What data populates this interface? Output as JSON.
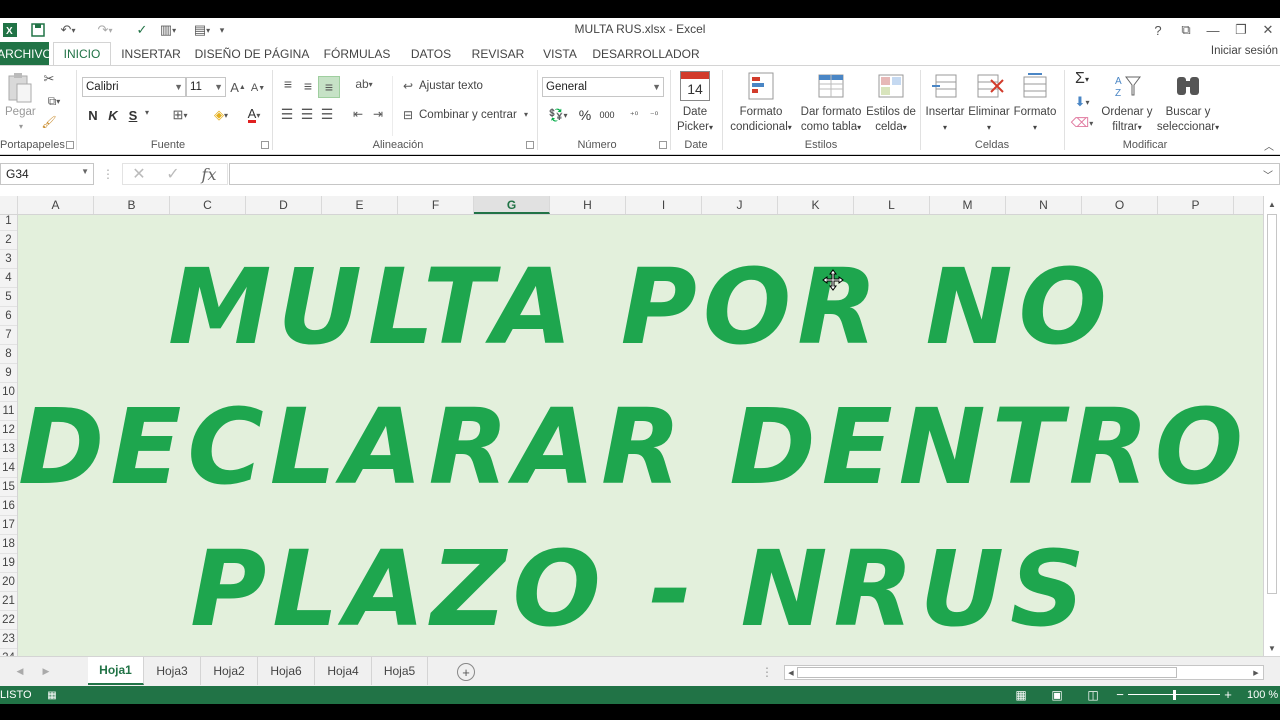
{
  "window": {
    "title": "MULTA RUS.xlsx - Excel",
    "help": "?",
    "restore_ribbon": "⧉",
    "minimize": "—",
    "maximize": "❐",
    "close": "✕"
  },
  "tabs": [
    "ARCHIVO",
    "INICIO",
    "INSERTAR",
    "DISEÑO DE PÁGINA",
    "FÓRMULAS",
    "DATOS",
    "REVISAR",
    "VISTA",
    "DESARROLLADOR"
  ],
  "signin": "Iniciar sesión",
  "ribbon": {
    "clipboard": {
      "pegar": "Pegar",
      "label": "Portapapeles"
    },
    "font": {
      "name": "Calibri",
      "size": "11",
      "bold": "N",
      "italic": "K",
      "underline": "S",
      "label": "Fuente",
      "grow": "A",
      "shrink": "A",
      "color_letter": "A"
    },
    "alignment": {
      "wrap": "Ajustar texto",
      "merge": "Combinar y centrar",
      "label": "Alineación"
    },
    "number": {
      "format": "General",
      "percent": "%",
      "thousands": "000",
      "label": "Número"
    },
    "date": {
      "day": "14",
      "line1": "Date",
      "line2": "Picker",
      "label": "Date"
    },
    "styles": {
      "cond_line1": "Formato",
      "cond_line2": "condicional",
      "table_line1": "Dar formato",
      "table_line2": "como tabla",
      "cell_line1": "Estilos de",
      "cell_line2": "celda",
      "label": "Estilos"
    },
    "cells": {
      "insert": "Insertar",
      "delete": "Eliminar",
      "format": "Formato",
      "label": "Celdas"
    },
    "editing": {
      "sort_line1": "Ordenar y",
      "sort_line2": "filtrar",
      "find_line1": "Buscar y",
      "find_line2": "seleccionar",
      "label": "Modificar"
    }
  },
  "formula_bar": {
    "name_box": "G34",
    "fx": "fx",
    "cancel": "✕",
    "enter": "✓",
    "content": ""
  },
  "columns": [
    "A",
    "B",
    "C",
    "D",
    "E",
    "F",
    "G",
    "H",
    "I",
    "J",
    "K",
    "L",
    "M",
    "N",
    "O",
    "P"
  ],
  "selected_column": "G",
  "rows": [
    "1",
    "2",
    "3",
    "4",
    "5",
    "6",
    "7",
    "8",
    "9",
    "10",
    "11",
    "12",
    "13",
    "14",
    "15",
    "16",
    "17",
    "18",
    "19",
    "20",
    "21",
    "22",
    "23",
    "24"
  ],
  "banner_lines": [
    "MULTA POR NO",
    "DECLARAR DENTRO DEL",
    "PLAZO - NRUS"
  ],
  "colors": {
    "accent": "#217346",
    "banner_text": "#1ea64e",
    "sheet_fill": "#e3f0dc"
  },
  "sheets": [
    "Hoja1",
    "Hoja3",
    "Hoja2",
    "Hoja6",
    "Hoja4",
    "Hoja5"
  ],
  "active_sheet": "Hoja1",
  "status": {
    "mode": "LISTO",
    "zoom": "100 %",
    "zoom_level": 1.0
  }
}
